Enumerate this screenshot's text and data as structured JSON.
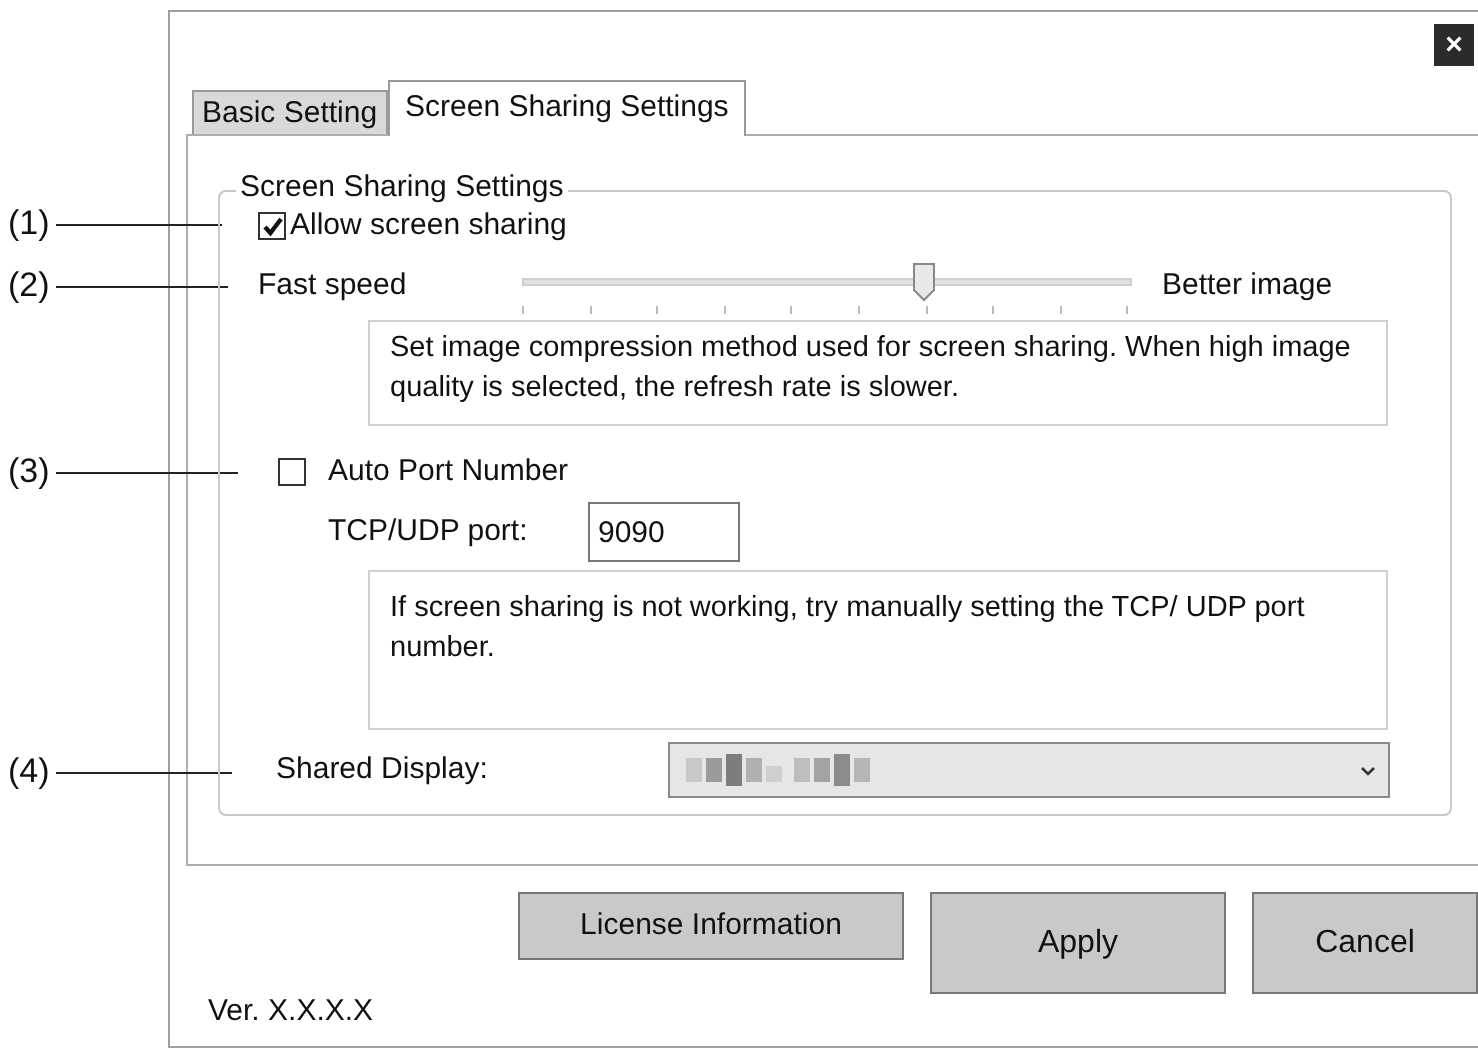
{
  "window": {
    "close": "×"
  },
  "tabs": [
    {
      "label": "Basic Setting",
      "selected": false
    },
    {
      "label": "Screen Sharing Settings",
      "selected": true
    }
  ],
  "group": {
    "title": "Screen Sharing Settings"
  },
  "allow_sharing": {
    "label": "Allow screen sharing",
    "checked": true
  },
  "slider": {
    "left_label": "Fast speed",
    "right_label": "Better image",
    "level": 0.667
  },
  "compression_note": "Set image compression method used for screen sharing. When high image quality is selected, the refresh rate is slower.",
  "auto_port": {
    "label": "Auto Port Number",
    "checked": false
  },
  "port": {
    "label": "TCP/UDP port:",
    "value": "9090"
  },
  "port_note": "If screen sharing is not working, try manually setting the TCP/ UDP port number.",
  "shared_display": {
    "label": "Shared Display:"
  },
  "buttons": [
    {
      "label": "License Information",
      "kind": "small"
    },
    {
      "label": "Apply",
      "kind": "large"
    },
    {
      "label": "Cancel",
      "kind": "large"
    }
  ],
  "version": "Ver. X.X.X.X",
  "callouts": [
    "(1)",
    "(2)",
    "(3)",
    "(4)"
  ]
}
